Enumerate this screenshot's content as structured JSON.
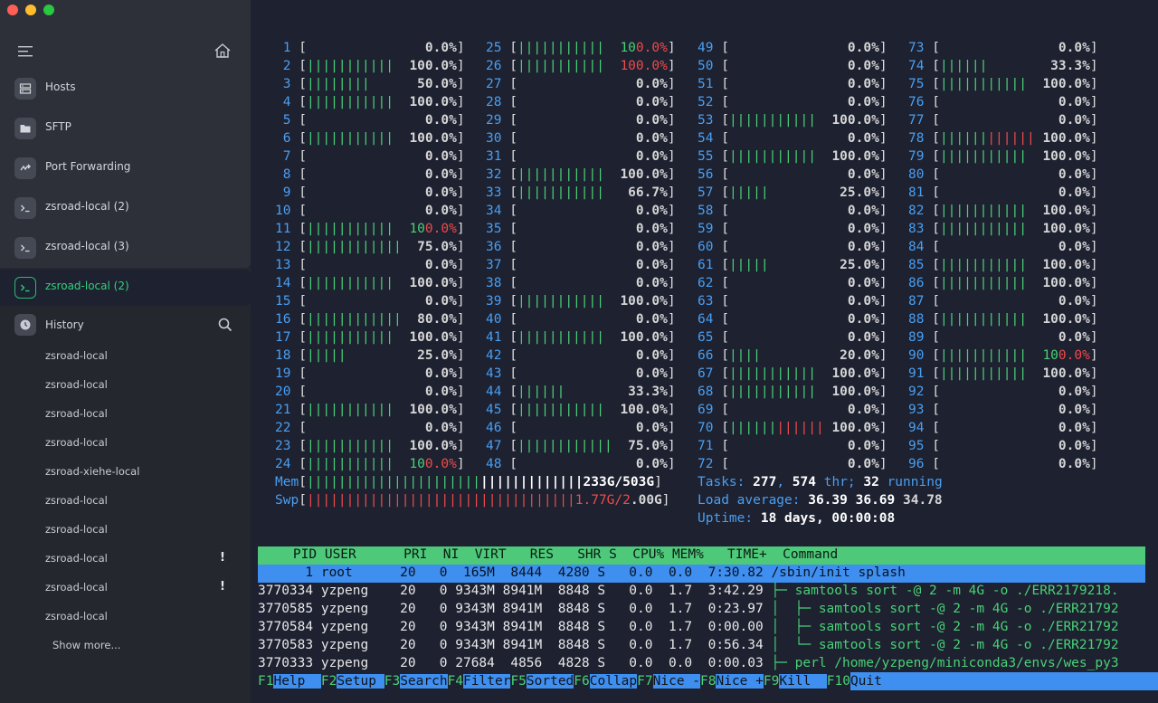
{
  "sidebar": {
    "nav": [
      {
        "label": "Hosts",
        "icon": "server-icon"
      },
      {
        "label": "SFTP",
        "icon": "folder-icon"
      },
      {
        "label": "Port Forwarding",
        "icon": "port-forward-icon"
      },
      {
        "label": "zsroad-local (2)",
        "icon": "terminal-icon"
      },
      {
        "label": "zsroad-local (3)",
        "icon": "terminal-icon"
      },
      {
        "label": "zsroad-local (2)",
        "icon": "terminal-icon",
        "active": true
      }
    ],
    "history_label": "History",
    "history": [
      {
        "label": "zsroad-local"
      },
      {
        "label": "zsroad-local"
      },
      {
        "label": "zsroad-local"
      },
      {
        "label": "zsroad-local"
      },
      {
        "label": "zsroad-xiehe-local"
      },
      {
        "label": "zsroad-local"
      },
      {
        "label": "zsroad-local"
      },
      {
        "label": "zsroad-local",
        "warn": "!"
      },
      {
        "label": "zsroad-local",
        "warn": "!"
      },
      {
        "label": "zsroad-local"
      }
    ],
    "show_more": "Show more..."
  },
  "htop": {
    "cpus": [
      [
        "0.0%",
        100,
        "0.0%",
        1
      ],
      [
        "100.0%",
        11,
        "100.0%",
        11
      ],
      [
        "50.0%",
        8,
        "0.0%",
        0
      ],
      [
        "100.0%",
        11,
        "0.0%",
        0
      ],
      [
        "0.0%",
        0,
        "0.0%",
        0
      ],
      [
        "100.0%",
        11,
        "0.0%",
        0
      ],
      [
        "0.0%",
        0,
        "0.0%",
        0
      ],
      [
        "0.0%",
        0,
        "100.0%",
        11
      ],
      [
        "0.0%",
        0,
        "66.7%",
        11
      ],
      [
        "0.0%",
        0,
        "0.0%",
        0
      ],
      [
        "100.0%",
        11,
        "0.0%",
        0
      ],
      [
        "75.0%",
        12,
        "0.0%",
        0
      ],
      [
        "0.0%",
        0,
        "0.0%",
        0
      ],
      [
        "100.0%",
        11,
        "0.0%",
        0
      ],
      [
        "0.0%",
        0,
        "100.0%",
        11
      ],
      [
        "80.0%",
        12,
        "0.0%",
        0
      ],
      [
        "100.0%",
        11,
        "100.0%",
        11
      ],
      [
        "25.0%",
        5,
        "0.0%",
        0
      ],
      [
        "0.0%",
        0,
        "0.0%",
        0
      ],
      [
        "0.0%",
        0,
        "33.3%",
        6
      ],
      [
        "100.0%",
        11,
        "100.0%",
        11
      ],
      [
        "0.0%",
        0,
        "0.0%",
        0
      ],
      [
        "100.0%",
        11,
        "75.0%",
        12
      ],
      [
        "100.0%",
        11,
        "0.0%",
        0
      ]
    ],
    "cpu_labels": {
      "c1": [
        "1",
        "2",
        "3",
        "4",
        "5",
        "6",
        "7",
        "8",
        "9",
        "10",
        "11",
        "12",
        "13",
        "14",
        "15",
        "16",
        "17",
        "18",
        "19",
        "20",
        "21",
        "22",
        "23",
        "24"
      ],
      "c2": [
        "25",
        "26",
        "27",
        "28",
        "29",
        "30",
        "31",
        "32",
        "33",
        "34",
        "35",
        "36",
        "37",
        "38",
        "39",
        "40",
        "41",
        "42",
        "43",
        "44",
        "45",
        "46",
        "47",
        "48"
      ],
      "c3": [
        "49",
        "50",
        "51",
        "52",
        "53",
        "54",
        "55",
        "56",
        "57",
        "58",
        "59",
        "60",
        "61",
        "62",
        "63",
        "64",
        "65",
        "66",
        "67",
        "68",
        "69",
        "70",
        "71",
        "72"
      ],
      "c4": [
        "73",
        "74",
        "75",
        "76",
        "77",
        "78",
        "79",
        "80",
        "81",
        "82",
        "83",
        "84",
        "85",
        "86",
        "87",
        "88",
        "89",
        "90",
        "91",
        "92",
        "93",
        "94",
        "95",
        "96"
      ]
    },
    "cpu_values": {
      "c1": [
        "0.0%",
        "100.0%",
        "50.0%",
        "100.0%",
        "0.0%",
        "100.0%",
        "0.0%",
        "0.0%",
        "0.0%",
        "0.0%",
        "100.0%",
        "75.0%",
        "0.0%",
        "100.0%",
        "0.0%",
        "80.0%",
        "100.0%",
        "25.0%",
        "0.0%",
        "0.0%",
        "100.0%",
        "0.0%",
        "100.0%",
        "100.0%"
      ],
      "c2": [
        "100.0%",
        "100.0%",
        "0.0%",
        "0.0%",
        "0.0%",
        "0.0%",
        "0.0%",
        "100.0%",
        "66.7%",
        "0.0%",
        "0.0%",
        "0.0%",
        "0.0%",
        "0.0%",
        "100.0%",
        "0.0%",
        "100.0%",
        "0.0%",
        "0.0%",
        "33.3%",
        "100.0%",
        "0.0%",
        "75.0%",
        "0.0%"
      ],
      "c3": [
        "0.0%",
        "0.0%",
        "0.0%",
        "0.0%",
        "100.0%",
        "0.0%",
        "100.0%",
        "0.0%",
        "25.0%",
        "0.0%",
        "0.0%",
        "0.0%",
        "25.0%",
        "0.0%",
        "0.0%",
        "0.0%",
        "0.0%",
        "20.0%",
        "100.0%",
        "100.0%",
        "0.0%",
        "100.0%",
        "0.0%",
        "0.0%"
      ],
      "c4": [
        "0.0%",
        "33.3%",
        "100.0%",
        "0.0%",
        "0.0%",
        "100.0%",
        "100.0%",
        "0.0%",
        "0.0%",
        "100.0%",
        "100.0%",
        "0.0%",
        "100.0%",
        "100.0%",
        "0.0%",
        "100.0%",
        "0.0%",
        "100.0%",
        "100.0%",
        "0.0%",
        "0.0%",
        "0.0%",
        "0.0%",
        "0.0%"
      ]
    },
    "mem_label": "Mem",
    "mem_value": "233G/503G",
    "swp_label": "Swp",
    "swp_used": "1.77G/2",
    "swp_total": ".00G",
    "tasks_label": "Tasks:",
    "tasks": "277",
    "thr": "574",
    "thr_label": "thr;",
    "running": "32",
    "running_label": "running",
    "load_label": "Load average:",
    "load1": "36.39",
    "load5": "36.69",
    "load15": "34.78",
    "uptime_label": "Uptime:",
    "uptime": "18 days, 00:00:08",
    "header": "    PID USER      PRI  NI  VIRT   RES   SHR S  CPU% MEM%   TIME+  Command",
    "processes": [
      {
        "pid": "      1",
        "user": "root",
        "pri": "20",
        "ni": "0",
        "virt": "165M",
        "res": "8444",
        "shr": "4280",
        "s": "S",
        "cpu": "0.0",
        "mem": "0.0",
        "time": "7:30.82",
        "cmd": "/sbin/init splash"
      },
      {
        "pid": "3770334",
        "user": "yzpeng",
        "pri": "20",
        "ni": "0",
        "virt": "9343M",
        "res": "8941M",
        "shr": "8848",
        "s": "S",
        "cpu": "0.0",
        "mem": "1.7",
        "time": "3:42.29",
        "cmd": "├─ samtools sort -@ 2 -m 4G -o ./ERR2179218."
      },
      {
        "pid": "3770585",
        "user": "yzpeng",
        "pri": "20",
        "ni": "0",
        "virt": "9343M",
        "res": "8941M",
        "shr": "8848",
        "s": "S",
        "cpu": "0.0",
        "mem": "1.7",
        "time": "0:23.97",
        "cmd": "│  ├─ samtools sort -@ 2 -m 4G -o ./ERR21792"
      },
      {
        "pid": "3770584",
        "user": "yzpeng",
        "pri": "20",
        "ni": "0",
        "virt": "9343M",
        "res": "8941M",
        "shr": "8848",
        "s": "S",
        "cpu": "0.0",
        "mem": "1.7",
        "time": "0:00.00",
        "cmd": "│  ├─ samtools sort -@ 2 -m 4G -o ./ERR21792"
      },
      {
        "pid": "3770583",
        "user": "yzpeng",
        "pri": "20",
        "ni": "0",
        "virt": "9343M",
        "res": "8941M",
        "shr": "8848",
        "s": "S",
        "cpu": "0.0",
        "mem": "1.7",
        "time": "0:56.34",
        "cmd": "│  └─ samtools sort -@ 2 -m 4G -o ./ERR21792"
      },
      {
        "pid": "3770333",
        "user": "yzpeng",
        "pri": "20",
        "ni": "0",
        "virt": "27684",
        "res": "4856",
        "shr": "4828",
        "s": "S",
        "cpu": "0.0",
        "mem": "0.0",
        "time": "0:00.03",
        "cmd": "├─ perl /home/yzpeng/miniconda3/envs/wes_py3"
      }
    ],
    "keys": [
      {
        "k": "F1",
        "v": "Help  "
      },
      {
        "k": "F2",
        "v": "Setup "
      },
      {
        "k": "F3",
        "v": "Search"
      },
      {
        "k": "F4",
        "v": "Filter"
      },
      {
        "k": "F5",
        "v": "Sorted"
      },
      {
        "k": "F6",
        "v": "Collap"
      },
      {
        "k": "F7",
        "v": "Nice -"
      },
      {
        "k": "F8",
        "v": "Nice +"
      },
      {
        "k": "F9",
        "v": "Kill  "
      },
      {
        "k": "F10",
        "v": "Quit"
      }
    ]
  },
  "colors": {
    "accent": "#33d17a",
    "bar_green": "#4ad176",
    "bar_red": "#ef4b4b",
    "label_blue": "#4a9ff2",
    "selected_row": "#3e8ff0"
  }
}
